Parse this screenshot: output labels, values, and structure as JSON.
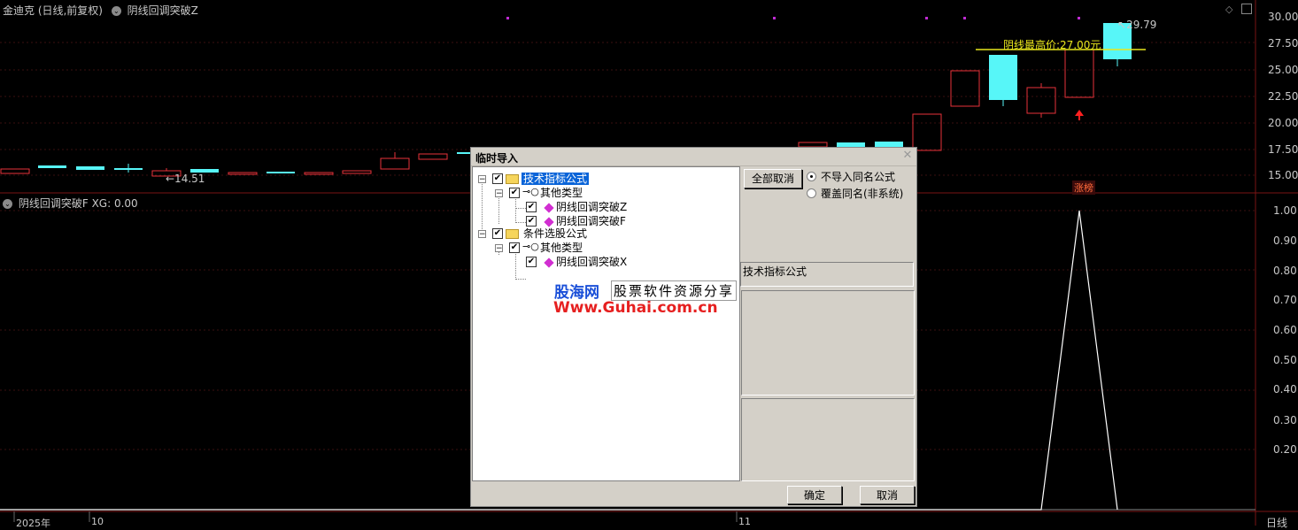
{
  "top_panel": {
    "stock_name": "金迪克 (日线,前复权)",
    "indicator_name": "阴线回调突破Z",
    "price_axis": [
      "30.00",
      "27.50",
      "25.00",
      "22.50",
      "20.00",
      "17.50",
      "15.00"
    ],
    "low_label": "←14.51",
    "high_label": "29.79",
    "yin_high_label": "阴线最高价:27.00元",
    "limit_board_label": "涨榜"
  },
  "bottom_panel": {
    "indicator_name": "阴线回调突破F",
    "xg_value": "XG: 0.00",
    "axis": [
      "1.00",
      "0.90",
      "0.80",
      "0.70",
      "0.60",
      "0.50",
      "0.40",
      "0.30",
      "0.20"
    ]
  },
  "time_axis": {
    "labels": [
      "2025年",
      "10",
      "11"
    ],
    "period": "日线"
  },
  "dialog": {
    "title": "临时导入",
    "close_icon": "close-icon",
    "tree": {
      "node1": "技术指标公式",
      "node1_child": "其他类型",
      "node1_items": [
        "阴线回调突破Z",
        "阴线回调突破F"
      ],
      "node2": "条件选股公式",
      "node2_child": "其他类型",
      "node2_items": [
        "阴线回调突破X"
      ]
    },
    "cancel_all_button": "全部取消",
    "radio_options": [
      "不导入同名公式",
      "覆盖同名(非系统)"
    ],
    "selected_radio": 0,
    "type_label": "技术指标公式",
    "ok_button": "确定",
    "cancel_button": "取消"
  },
  "watermark": {
    "site_name": "股海网",
    "slogan": "股票软件资源分享",
    "url": "Www.Guhai.com.cn"
  },
  "colors": {
    "up_candle": "#e8323a",
    "down_candle": "#57f6f8",
    "signal_line": "#ffffff",
    "marker_magenta": "#c02bd4",
    "highlight_yellow": "#e8e61c"
  }
}
